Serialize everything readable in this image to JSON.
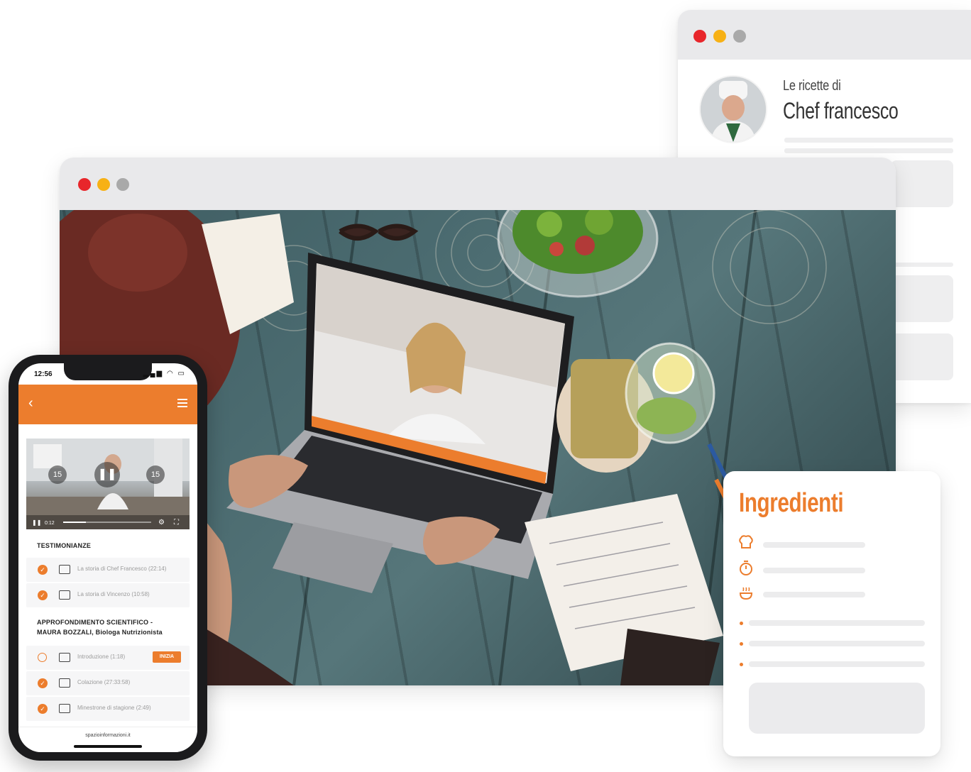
{
  "colors": {
    "accent": "#ec7d2d",
    "dot_red": "#e8262b",
    "dot_yellow": "#f7b115",
    "dot_gray": "#a9a9a9",
    "titlebar": "#e9e9eb"
  },
  "chef_window": {
    "subtitle": "Le ricette di",
    "name": "Chef francesco"
  },
  "ingredients_card": {
    "title": "Ingredienti",
    "icons": [
      "chef-hat-icon",
      "timer-icon",
      "cooking-pot-icon"
    ]
  },
  "phone": {
    "status_time": "12:56",
    "status_icons": "signal-icon wifi-icon battery-icon",
    "player": {
      "time": "0:12",
      "rewind_label": "15",
      "forward_label": "15"
    },
    "sections": [
      {
        "title": "TESTIMONIANZE",
        "lessons": [
          {
            "text": "La storia di Chef Francesco (22:14)",
            "done": true
          },
          {
            "text": "La storia di Vincenzo (10:58)",
            "done": true
          }
        ]
      },
      {
        "title_line1": "APPROFONDIMENTO SCIENTIFICO -",
        "title_line2": "MAURA BOZZALI, Biologa Nutrizionista",
        "lessons": [
          {
            "text": "Introduzione (1:18)",
            "done": false,
            "badge": "INIZIA"
          },
          {
            "text": "Colazione (27:33:58)",
            "done": true
          },
          {
            "text": "Minestrone di stagione (2:49)",
            "done": true
          }
        ]
      }
    ],
    "footer_url": "spazioinformazioni.it"
  }
}
